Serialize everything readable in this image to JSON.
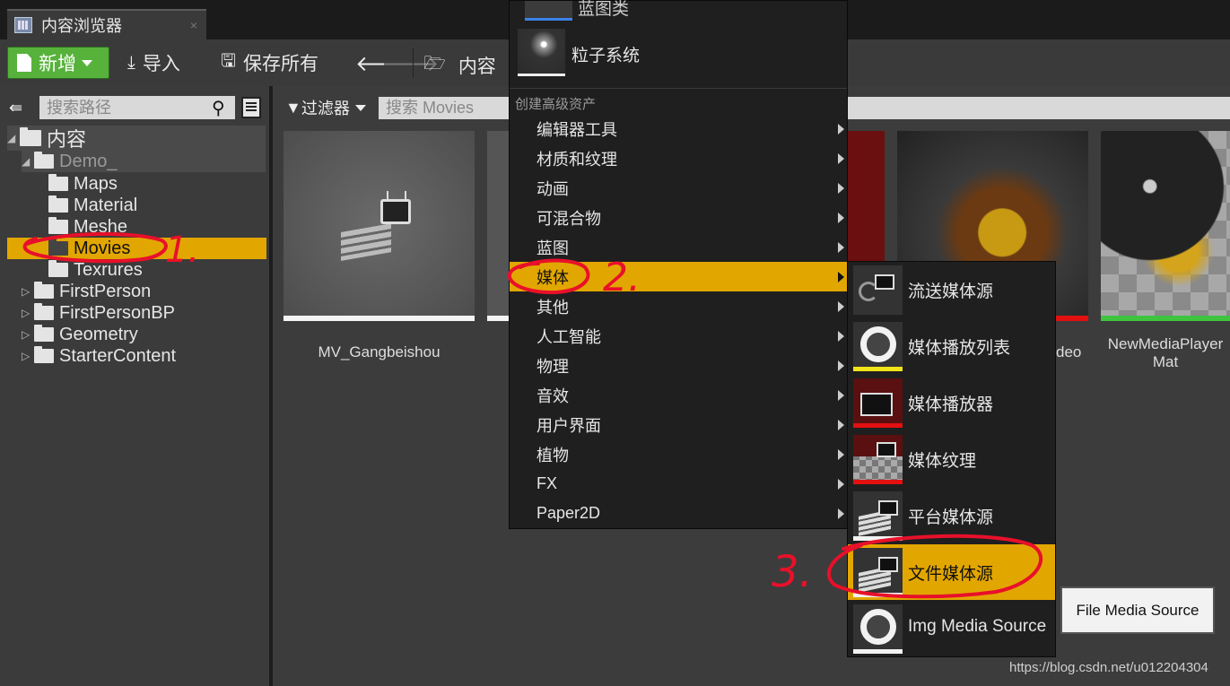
{
  "tab": {
    "title": "内容浏览器",
    "close": "×"
  },
  "toolbar": {
    "new_label": "新增",
    "import_label": "导入",
    "saveall_label": "保存所有",
    "breadcrumb": "内容"
  },
  "left_panel": {
    "search_placeholder": "搜索路径",
    "tree": {
      "root": "内容",
      "demo": "Demo_",
      "maps": "Maps",
      "material": "Material",
      "meshes": "Meshe",
      "movies": "Movies",
      "texrures": "Texrures",
      "firstperson": "FirstPerson",
      "firstpersonbp": "FirstPersonBP",
      "geometry": "Geometry",
      "startercontent": "StarterContent"
    }
  },
  "content_area": {
    "filter_label": "过滤器",
    "search_placeholder": "搜索 Movies",
    "assets": {
      "a1": "MV_Gangbeishou",
      "a4": "deo",
      "a5_line1": "NewMediaPlayer",
      "a5_line2": "Mat"
    }
  },
  "context_menu": {
    "top_item": "蓝图类",
    "particle_item": "粒子系统",
    "header": "创建高级资产",
    "items": [
      "编辑器工具",
      "材质和纹理",
      "动画",
      "可混合物",
      "蓝图",
      "媒体",
      "其他",
      "人工智能",
      "物理",
      "音效",
      "用户界面",
      "植物",
      "FX",
      "Paper2D"
    ]
  },
  "submenu": {
    "items": [
      "流送媒体源",
      "媒体播放列表",
      "媒体播放器",
      "媒体纹理",
      "平台媒体源",
      "文件媒体源",
      "Img Media Source"
    ],
    "bar_colors": [
      "#1f1f1f",
      "#f2e418",
      "#e31010",
      "#e31010",
      "#f2f2f2",
      "#f2f2f2",
      "#f2f2f2"
    ]
  },
  "tooltip": "File Media Source",
  "watermark": "https://blog.csdn.net/u012204304",
  "annotations": {
    "step1": "1.",
    "step2": "2.",
    "step3": "3.",
    "color": "#e8102a"
  },
  "colors": {
    "accent": "#e2a600",
    "new_button": "#56b23a"
  }
}
